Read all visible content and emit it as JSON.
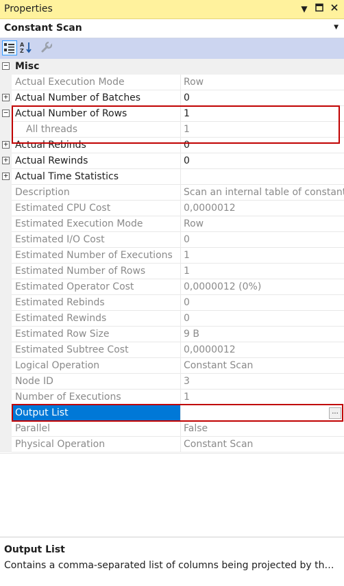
{
  "window": {
    "title": "Properties",
    "controls": [
      "pin",
      "maximize",
      "close"
    ]
  },
  "object_selector": {
    "value": "Constant Scan"
  },
  "toolbar": {
    "buttons": [
      "categorized",
      "alphabetical",
      "property-pages"
    ]
  },
  "category": {
    "name": "Misc"
  },
  "rows": [
    {
      "name": "Actual Execution Mode",
      "value": "Row"
    },
    {
      "name": "Actual Number of Batches",
      "value": "0"
    },
    {
      "name": "Actual Number of Rows",
      "value": "1"
    },
    {
      "name": "All threads",
      "value": "1"
    },
    {
      "name": "Actual Rebinds",
      "value": "0"
    },
    {
      "name": "Actual Rewinds",
      "value": "0"
    },
    {
      "name": "Actual Time Statistics",
      "value": ""
    },
    {
      "name": "Description",
      "value": "Scan an internal table of constants."
    },
    {
      "name": "Estimated CPU Cost",
      "value": "0,0000012"
    },
    {
      "name": "Estimated Execution Mode",
      "value": "Row"
    },
    {
      "name": "Estimated I/O Cost",
      "value": "0"
    },
    {
      "name": "Estimated Number of Executions",
      "value": "1"
    },
    {
      "name": "Estimated Number of Rows",
      "value": "1"
    },
    {
      "name": "Estimated Operator Cost",
      "value": "0,0000012 (0%)"
    },
    {
      "name": "Estimated Rebinds",
      "value": "0"
    },
    {
      "name": "Estimated Rewinds",
      "value": "0"
    },
    {
      "name": "Estimated Row Size",
      "value": "9 B"
    },
    {
      "name": "Estimated Subtree Cost",
      "value": "0,0000012"
    },
    {
      "name": "Logical Operation",
      "value": "Constant Scan"
    },
    {
      "name": "Node ID",
      "value": "3"
    },
    {
      "name": "Number of Executions",
      "value": "1"
    },
    {
      "name": "Output List",
      "value": "",
      "button": "..."
    },
    {
      "name": "Parallel",
      "value": "False"
    },
    {
      "name": "Physical Operation",
      "value": "Constant Scan"
    }
  ],
  "description_pane": {
    "title": "Output List",
    "text": "Contains a comma-separated list of columns being projected by the cur..."
  },
  "colors": {
    "titlebar": "#fff29d",
    "selection": "#0078d7",
    "highlight_border": "#c00000",
    "toolbar": "#ccd5f0"
  }
}
